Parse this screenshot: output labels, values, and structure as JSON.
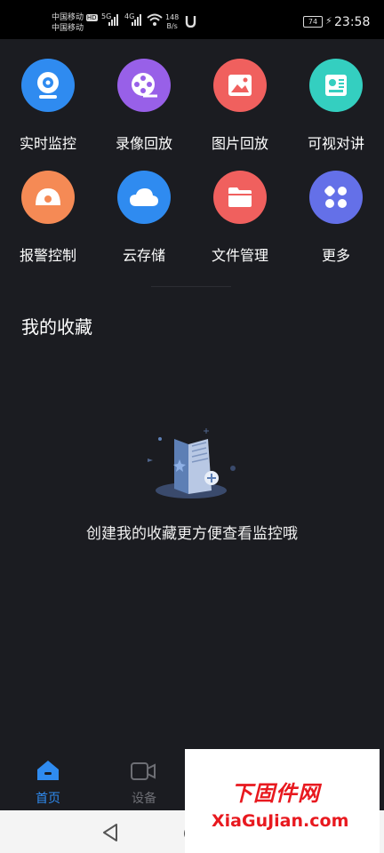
{
  "status": {
    "carrier1": "中国移动",
    "carrier2": "中国移动",
    "hd": "HD",
    "net1": "5G",
    "net2": "4G",
    "speed_value": "148",
    "speed_unit": "B/s",
    "battery": "74",
    "time": "23:58"
  },
  "grid": [
    {
      "label": "实时监控",
      "icon": "camera-icon",
      "color": "#2f8bf0"
    },
    {
      "label": "录像回放",
      "icon": "film-reel-icon",
      "color": "#9860e8"
    },
    {
      "label": "图片回放",
      "icon": "image-icon",
      "color": "#f0605e"
    },
    {
      "label": "可视对讲",
      "icon": "intercom-icon",
      "color": "#34cfc0"
    },
    {
      "label": "报警控制",
      "icon": "alarm-icon",
      "color": "#f58a55"
    },
    {
      "label": "云存储",
      "icon": "cloud-icon",
      "color": "#2f8bf0"
    },
    {
      "label": "文件管理",
      "icon": "folder-icon",
      "color": "#f0605e"
    },
    {
      "label": "更多",
      "icon": "more-icon",
      "color": "#6470e8"
    }
  ],
  "favorites": {
    "title": "我的收藏",
    "empty_text": "创建我的收藏更方便查看监控哦"
  },
  "tabs": [
    {
      "label": "首页",
      "icon": "home-icon",
      "active": true
    },
    {
      "label": "设备",
      "icon": "device-icon",
      "active": false
    }
  ],
  "watermark": {
    "title": "下固件网",
    "url": "XiaGuJian.com"
  },
  "colors": {
    "background": "#1b1c21",
    "active_tab": "#2f8bf0",
    "inactive_tab": "#6d6e74"
  }
}
